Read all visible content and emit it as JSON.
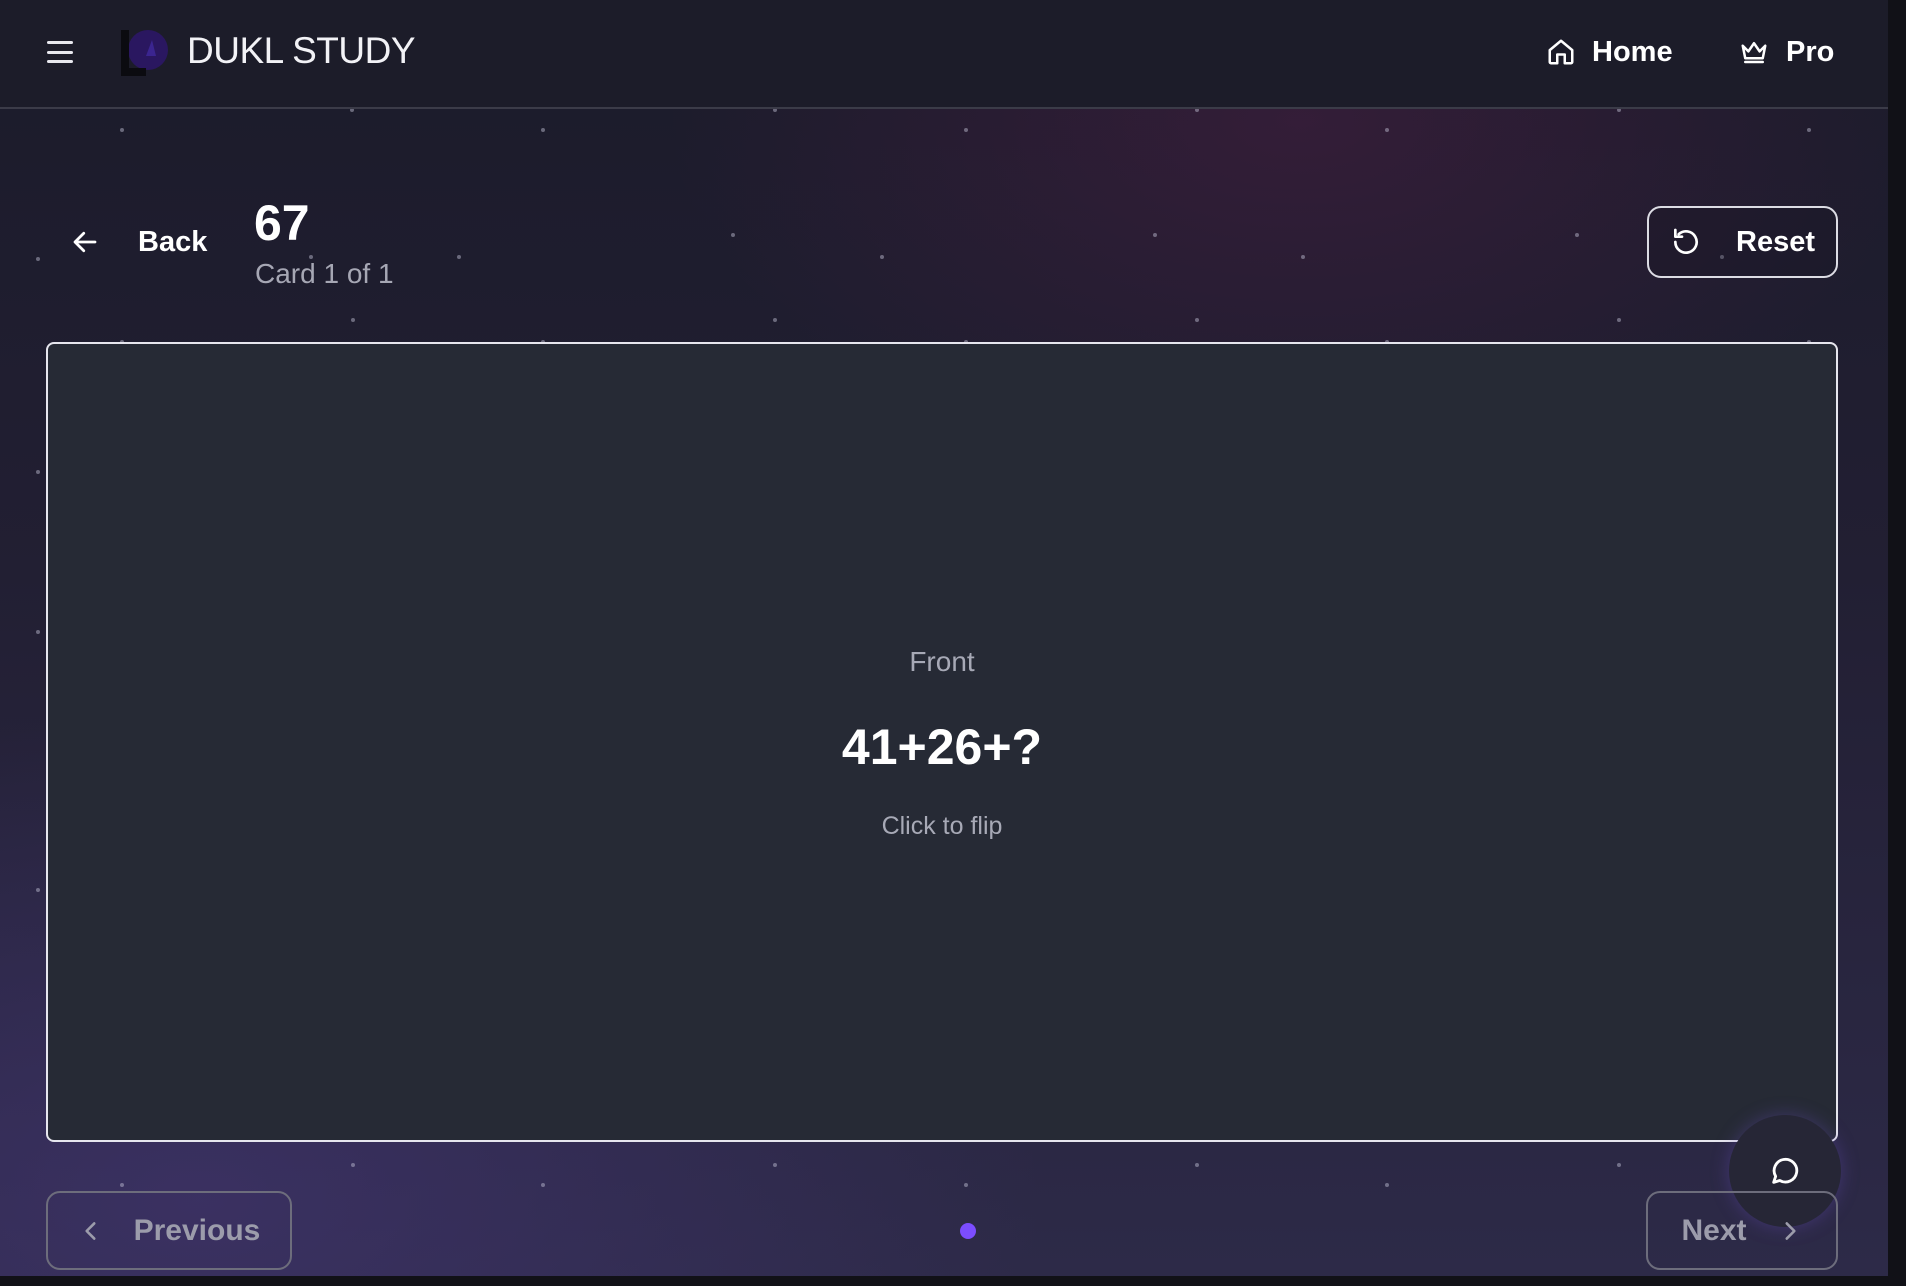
{
  "header": {
    "brand": "DUKL STUDY",
    "nav": [
      {
        "label": "Home",
        "icon": "home-icon"
      },
      {
        "label": "Pro",
        "icon": "crown-icon"
      }
    ]
  },
  "study": {
    "back_label": "Back",
    "deck_title": "67",
    "card_count": "Card 1 of 1",
    "reset_label": "Reset"
  },
  "card": {
    "side_label": "Front",
    "question": "41+26+?",
    "hint": "Click to flip"
  },
  "pagination": {
    "previous_label": "Previous",
    "next_label": "Next",
    "current": 1,
    "total": 1
  },
  "colors": {
    "accent": "#7c4dff",
    "card_bg": "#262a35",
    "header_bg": "#1c1c29"
  }
}
